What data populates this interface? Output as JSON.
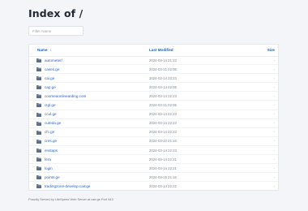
{
  "page": {
    "title": "Index of /"
  },
  "filter": {
    "placeholder": "Filter Name"
  },
  "table": {
    "headers": {
      "name": "Name",
      "modified": "Last Modified",
      "size": "Size"
    },
    "rows": [
      {
        "name": "autometer/",
        "modified": "2024-03-14 21:23",
        "size": "-"
      },
      {
        "name": "cases.ge",
        "modified": "2024-03-21 02:05",
        "size": "-"
      },
      {
        "name": "cai.ge",
        "modified": "2024-03-14 22:23",
        "size": "-"
      },
      {
        "name": "cap.ge",
        "modified": "2024-03-14 02:05",
        "size": "-"
      },
      {
        "name": "courseaonlinearding.com",
        "modified": "2024-03-14 22:23",
        "size": "-"
      },
      {
        "name": "ctgl.ge",
        "modified": "2024-03-21 02:05",
        "size": "-"
      },
      {
        "name": "ccul.ge",
        "modified": "2024-03-14 22:23",
        "size": "-"
      },
      {
        "name": "cuteda.ge",
        "modified": "2024-03-14 22:23",
        "size": "-"
      },
      {
        "name": "cfc.ge",
        "modified": "2024-03-14 22:23",
        "size": "-"
      },
      {
        "name": "cres.ge",
        "modified": "2024-03-10 21:16",
        "size": "-"
      },
      {
        "name": "enstaps",
        "modified": "2024-03-14 22:23",
        "size": "-"
      },
      {
        "name": "fera",
        "modified": "2024-03-14 22:21",
        "size": "-"
      },
      {
        "name": "login",
        "modified": "2024-03-14 22:21",
        "size": "-"
      },
      {
        "name": "points.ge",
        "modified": "2024-03-15 21:16",
        "size": "-"
      },
      {
        "name": "tradingzone-develop.cair.ge",
        "modified": "2024-03-14 22:22",
        "size": "-"
      }
    ]
  },
  "footer": {
    "text": "Proudly Served by LiteSpeed Web Server at cair.ge Port 443"
  },
  "colors": {
    "link": "#2563c9",
    "folder": "#5b6f8c",
    "background": "#f3f5f9"
  },
  "icons": {
    "row_icon": "folder-icon",
    "sort_icon": "sort-arrow-icon"
  }
}
